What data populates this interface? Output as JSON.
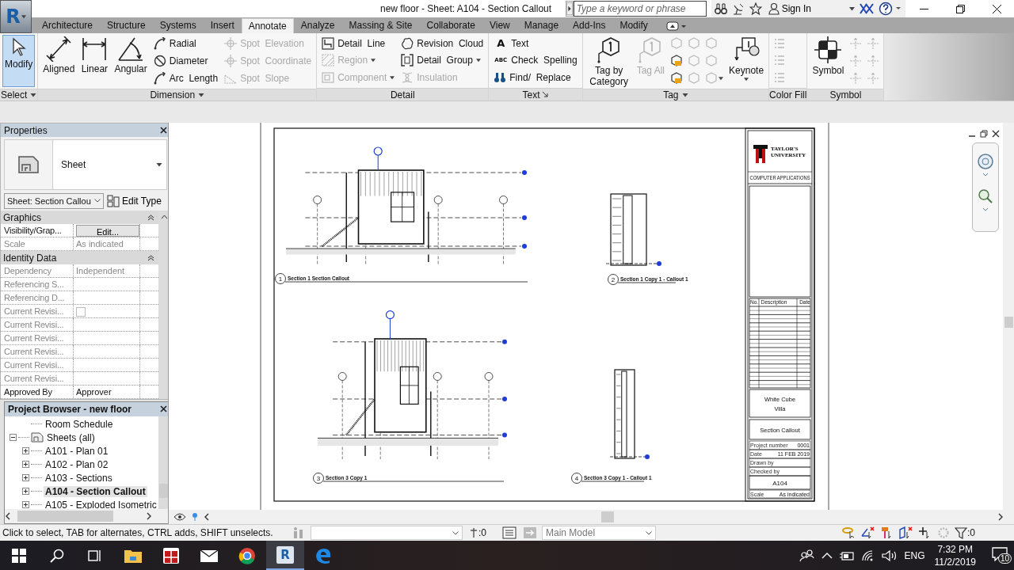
{
  "app_button": {
    "glyph": "R"
  },
  "window": {
    "title": "new floor - Sheet: A104 - Section Callout"
  },
  "search": {
    "placeholder": "Type a keyword or phrase"
  },
  "account": {
    "label": "Sign In"
  },
  "tabs": [
    {
      "label": "Architecture",
      "selected": false
    },
    {
      "label": "Structure",
      "selected": false
    },
    {
      "label": "Systems",
      "selected": false
    },
    {
      "label": "Insert",
      "selected": false
    },
    {
      "label": "Annotate",
      "selected": true
    },
    {
      "label": "Analyze",
      "selected": false
    },
    {
      "label": "Massing & Site",
      "selected": false
    },
    {
      "label": "Collaborate",
      "selected": false
    },
    {
      "label": "View",
      "selected": false
    },
    {
      "label": "Manage",
      "selected": false
    },
    {
      "label": "Add-Ins",
      "selected": false
    },
    {
      "label": "Modify",
      "selected": false
    }
  ],
  "ribbon": {
    "panels": [
      {
        "label": "Select",
        "menu_arrow": true,
        "columns": [
          [
            {
              "label": "Modify",
              "kind": "large",
              "active": true,
              "disabled": false
            }
          ]
        ]
      },
      {
        "label": "Dimension",
        "menu_arrow": true,
        "columns": [
          [
            {
              "label": "Aligned",
              "kind": "large",
              "disabled": false
            }
          ],
          [
            {
              "label": "Linear",
              "kind": "large",
              "disabled": false
            }
          ],
          [
            {
              "label": "Angular",
              "kind": "large",
              "disabled": false
            }
          ],
          [
            {
              "label": "Radial",
              "kind": "small",
              "disabled": false
            },
            {
              "label": "Diameter",
              "kind": "small",
              "disabled": false
            },
            {
              "label": "Arc  Length",
              "kind": "small",
              "disabled": false
            }
          ],
          [
            {
              "label": "Spot  Elevation",
              "kind": "small",
              "disabled": true
            },
            {
              "label": "Spot  Coordinate",
              "kind": "small",
              "disabled": true
            },
            {
              "label": "Spot  Slope",
              "kind": "small",
              "disabled": true
            }
          ]
        ]
      },
      {
        "label": "Detail",
        "columns": [
          [
            {
              "label": "Detail  Line",
              "kind": "small",
              "disabled": false
            },
            {
              "label": "Region",
              "kind": "small",
              "disabled": true,
              "dropdown": true
            },
            {
              "label": "Component",
              "kind": "small",
              "disabled": true,
              "dropdown": true
            }
          ],
          [
            {
              "label": "Revision  Cloud",
              "kind": "small",
              "disabled": false
            },
            {
              "label": "Detail  Group",
              "kind": "small",
              "disabled": false,
              "dropdown": true
            },
            {
              "label": "Insulation",
              "kind": "small",
              "disabled": true
            }
          ]
        ]
      },
      {
        "label": "Text",
        "launcher": true,
        "columns": [
          [
            {
              "label": "Text",
              "glyph": "A",
              "kind": "small",
              "disabled": false
            },
            {
              "label": "Check  Spelling",
              "glyph": "ABC",
              "kind": "small",
              "disabled": false
            },
            {
              "label": "Find/  Replace",
              "kind": "small",
              "disabled": false
            }
          ]
        ]
      },
      {
        "label": "Tag",
        "menu_arrow": true,
        "columns": [
          [
            {
              "label": "Tag by Category",
              "kind": "large",
              "disabled": false
            }
          ],
          [
            {
              "label": "Tag All",
              "kind": "large",
              "disabled": true
            }
          ],
          [
            {
              "kind": "icon",
              "disabled": true
            },
            {
              "kind": "icon",
              "disabled": false
            },
            {
              "kind": "icon",
              "disabled": false
            }
          ],
          [
            {
              "kind": "icon",
              "disabled": true
            },
            {
              "kind": "icon",
              "disabled": true
            },
            {
              "kind": "icon",
              "disabled": true
            }
          ],
          [
            {
              "kind": "icon",
              "disabled": true
            },
            {
              "kind": "icon",
              "disabled": true
            },
            {
              "kind": "icon",
              "disabled": true,
              "dropdown": true
            }
          ],
          [
            {
              "label": "Keynote",
              "kind": "large",
              "disabled": false,
              "dropdown": true
            }
          ]
        ]
      },
      {
        "label": "Color Fill",
        "columns": [
          [
            {
              "kind": "icon",
              "disabled": true
            },
            {
              "kind": "icon",
              "disabled": true
            },
            {
              "kind": "icon",
              "disabled": true
            }
          ]
        ]
      },
      {
        "label": "Symbol",
        "columns": [
          [
            {
              "label": "Symbol",
              "kind": "large",
              "disabled": false
            }
          ],
          [
            {
              "kind": "icon",
              "disabled": true
            },
            {
              "kind": "icon",
              "disabled": true
            },
            {
              "kind": "icon",
              "disabled": true
            }
          ],
          [
            {
              "kind": "icon",
              "disabled": true
            },
            {
              "kind": "icon",
              "disabled": true
            },
            {
              "kind": "icon",
              "disabled": true
            }
          ]
        ]
      }
    ]
  },
  "properties": {
    "title": "Properties",
    "type": {
      "label": "Sheet"
    },
    "selector": {
      "value": "Sheet: Section Callou"
    },
    "edit_type": "Edit Type",
    "groups": [
      {
        "label": "Graphics",
        "expanded": true,
        "rows": [
          {
            "name": "Visibility/Grap...",
            "value": "Edit...",
            "kind": "button",
            "disabled": false
          },
          {
            "name": "Scale",
            "value": "As indicated",
            "kind": "text",
            "disabled": true
          }
        ]
      },
      {
        "label": "Identity Data",
        "expanded": true,
        "rows": [
          {
            "name": "Dependency",
            "value": "Independent",
            "kind": "text",
            "disabled": true
          },
          {
            "name": "Referencing S...",
            "kind": "text",
            "disabled": true
          },
          {
            "name": "Referencing D...",
            "kind": "text",
            "disabled": true
          },
          {
            "name": "Current Revisi...",
            "kind": "checkbox",
            "checked": false,
            "disabled": true
          },
          {
            "name": "Current Revisi...",
            "kind": "text",
            "disabled": true
          },
          {
            "name": "Current Revisi...",
            "kind": "text",
            "disabled": true
          },
          {
            "name": "Current Revisi...",
            "kind": "text",
            "disabled": true
          },
          {
            "name": "Current Revisi...",
            "kind": "text",
            "disabled": true
          },
          {
            "name": "Current Revisi...",
            "kind": "text",
            "disabled": true
          },
          {
            "name": "Approved By",
            "value": "Approver",
            "kind": "text",
            "disabled": false
          }
        ]
      }
    ]
  },
  "project_browser": {
    "title": "Project Browser - new floor",
    "items": [
      {
        "label": "Room Schedule"
      },
      {
        "label": "Sheets (all)",
        "expanded": true,
        "children": [
          {
            "label": "A101 - Plan 01",
            "expanded": false,
            "selected": false
          },
          {
            "label": "A102 - Plan 02",
            "expanded": false,
            "selected": false
          },
          {
            "label": "A103 - Sections",
            "expanded": false,
            "selected": false
          },
          {
            "label": "A104 - Section Callout",
            "expanded": false,
            "selected": true
          },
          {
            "label": "A105 - Exploded Isometric",
            "expanded": false,
            "selected": false
          }
        ]
      }
    ]
  },
  "sheet": {
    "views": [
      {
        "kind": "section",
        "number": "1",
        "title": "Section 1 Section Callout"
      },
      {
        "kind": "callout",
        "number": "2",
        "title": "Section 1 Copy 1 - Callout 1"
      },
      {
        "kind": "section",
        "number": "3",
        "title": "Section 3 Copy 1"
      },
      {
        "kind": "callout",
        "number": "4",
        "title": "Section 3 Copy 1 - Callout 1"
      }
    ],
    "title_block": {
      "school": [
        "TAYLOR'S",
        "UNIVERSITY"
      ],
      "course": "COMPUTER APPLICATIONS",
      "revision_columns": [
        "No.",
        "Description",
        "Date"
      ],
      "project": [
        "White Cube",
        "Villa"
      ],
      "sheet_name": "Section Callout",
      "fields": [
        {
          "label": "Project number",
          "value": "0001"
        },
        {
          "label": "Date",
          "value": "11 FEB 2019"
        },
        {
          "label": "Drawn by"
        },
        {
          "label": "Checked by"
        }
      ],
      "sheet_number": "A104",
      "scale": {
        "label": "Scale",
        "value": "As indicated"
      }
    }
  },
  "status_bar": {
    "hint": "Click to select, TAB for alternates, CTRL adds, SHIFT unselects.",
    "workset_count": ":0",
    "design_option": "Main Model",
    "filter_count": ":0"
  },
  "taskbar": {
    "apps": [
      {
        "kind": "explorer",
        "active": false
      },
      {
        "kind": "gift",
        "active": false
      },
      {
        "kind": "mail",
        "active": false
      },
      {
        "kind": "chrome",
        "active": false
      },
      {
        "kind": "revit",
        "glyph": "R",
        "active": true
      },
      {
        "kind": "edge",
        "active": false
      }
    ],
    "language": "ENG",
    "time": "7:32 PM",
    "date": "11/2/2019",
    "notifications": "10"
  }
}
